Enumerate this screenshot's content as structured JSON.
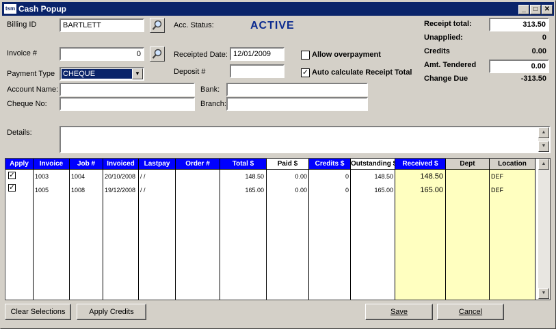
{
  "window": {
    "app_icon_text": "tsm",
    "title": "Cash Popup",
    "minimize": "_",
    "maximize": "□",
    "close": "✕"
  },
  "form": {
    "billing_id_label": "Billing ID",
    "billing_id_value": "BARTLETT",
    "acc_status_label": "Acc. Status:",
    "acc_status_value": "ACTIVE",
    "invoice_label": "Invoice #",
    "invoice_value": "0",
    "receipted_date_label": "Receipted Date:",
    "receipted_date_value": "12/01/2009",
    "allow_overpayment_label": "Allow overpayment",
    "allow_overpayment_checked": false,
    "payment_type_label": "Payment Type",
    "payment_type_value": "CHEQUE",
    "deposit_label": "Deposit #",
    "deposit_value": "",
    "auto_calc_label": "Auto calculate Receipt Total",
    "auto_calc_checked": true,
    "account_name_label": "Account Name:",
    "account_name_value": "",
    "bank_label": "Bank:",
    "bank_value": "",
    "cheque_no_label": "Cheque No:",
    "cheque_no_value": "",
    "branch_label": "Branch:",
    "branch_value": "",
    "details_label": "Details:",
    "details_value": ""
  },
  "summary": {
    "receipt_total_label": "Receipt total:",
    "receipt_total_value": "313.50",
    "unapplied_label": "Unapplied:",
    "unapplied_value": "0",
    "credits_label": "Credits",
    "credits_value": "0.00",
    "amt_tendered_label": "Amt. Tendered",
    "amt_tendered_value": "0.00",
    "change_due_label": "Change Due",
    "change_due_value": "-313.50"
  },
  "grid": {
    "columns": [
      "Apply",
      "Invoice",
      "Job #",
      "Invoiced",
      "Lastpay",
      "Order #",
      "Total $",
      "Paid $",
      "Credits $",
      "Outstanding $",
      "Received $",
      "Dept",
      "Location"
    ],
    "rows": [
      {
        "apply": "✓",
        "invoice": "1003",
        "job": "1004",
        "invoiced": "20/10/2008",
        "lastpay": "/ /",
        "order": "",
        "total": "148.50",
        "paid": "0.00",
        "credits": "0",
        "outstanding": "148.50",
        "received": "148.50",
        "dept": "",
        "location": "DEF"
      },
      {
        "apply": "✓",
        "invoice": "1005",
        "job": "1008",
        "invoiced": "19/12/2008",
        "lastpay": "/ /",
        "order": "",
        "total": "165.00",
        "paid": "0.00",
        "credits": "0",
        "outstanding": "165.00",
        "received": "165.00",
        "dept": "",
        "location": "DEF"
      }
    ]
  },
  "buttons": {
    "clear_selections": "Clear Selections",
    "apply_credits": "Apply Credits",
    "save": "Save",
    "cancel": "Cancel"
  },
  "colors": {
    "title_bar": "#0a246a",
    "header_blue": "#0000ff",
    "received_bg": "#ffffc0",
    "status_text": "#0b2a8f"
  }
}
